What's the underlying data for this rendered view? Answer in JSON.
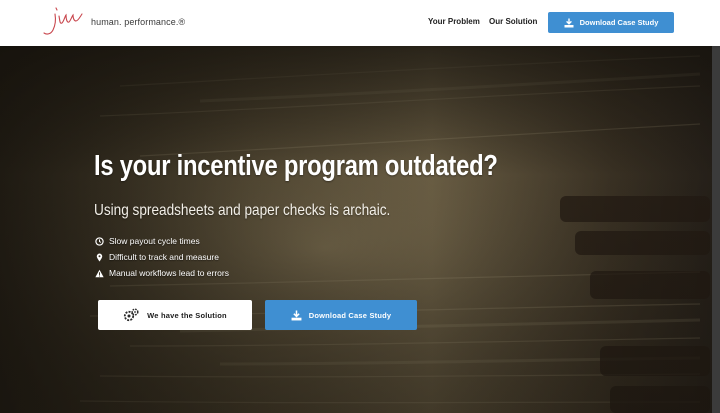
{
  "header": {
    "logo_tagline": "human. performance.®",
    "nav": [
      {
        "label": "Your Problem"
      },
      {
        "label": "Our Solution"
      }
    ],
    "download_label": "Download Case Study"
  },
  "hero": {
    "title": "Is your incentive program outdated?",
    "subtitle": "Using spreadsheets and paper checks is archaic.",
    "bullets": [
      {
        "icon": "clock-icon",
        "text": "Slow payout cycle times"
      },
      {
        "icon": "map-pin-icon",
        "text": "Difficult to track and measure"
      },
      {
        "icon": "warning-icon",
        "text": "Manual workflows lead to errors"
      }
    ],
    "solution_button_label": "We have the Solution",
    "download_button_label": "Download Case Study"
  },
  "colors": {
    "accent_blue": "#3f8fd2",
    "logo_red": "#c8464d",
    "header_bg": "#ffffff"
  }
}
